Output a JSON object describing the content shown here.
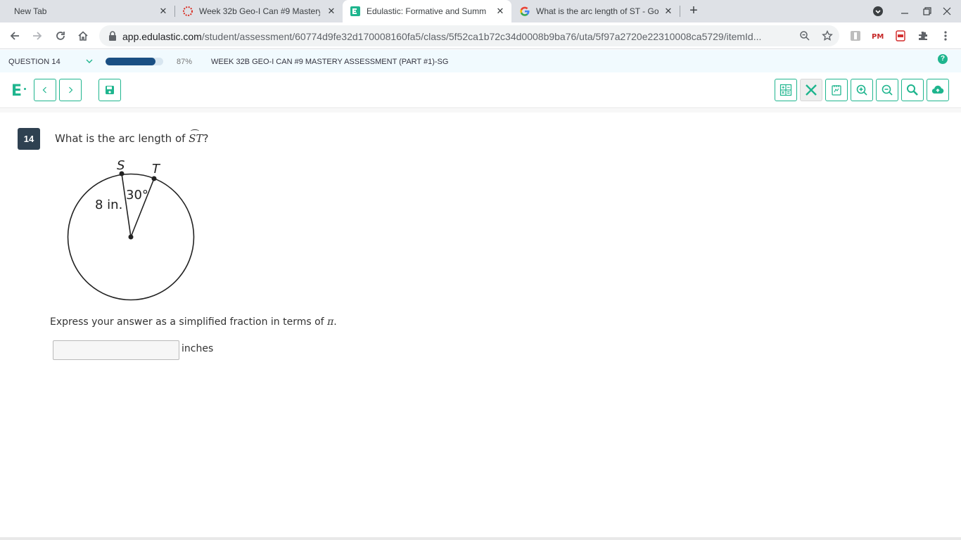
{
  "browser": {
    "tabs": [
      {
        "title": "New Tab",
        "favicon": "none",
        "active": false
      },
      {
        "title": "Week 32b Geo-I Can #9 Mastery",
        "favicon": "red-dotted-circle-icon",
        "active": false
      },
      {
        "title": "Edulastic: Formative and Summ",
        "favicon": "edulastic-icon",
        "active": true
      },
      {
        "title": "What is the arc length of ST - Go",
        "favicon": "google-icon",
        "active": false
      }
    ],
    "url_host": "app.edulastic.com",
    "url_path": "/student/assessment/60774d9fe32d170008160fa5/class/5f52ca1b72c34d0008b9ba76/uta/5f97a2720e22310008ca5729/itemId..."
  },
  "assessment": {
    "question_label": "QUESTION 14",
    "progress_percent": 87,
    "progress_text": "87%",
    "title": "WEEK 32B GEO-I CAN #9 MASTERY ASSESSMENT (PART #1)-SG",
    "help_label": "?"
  },
  "question": {
    "number": "14",
    "prompt_before": "What is the arc length of ",
    "arc_name": "ST",
    "prompt_after": "?",
    "figure": {
      "point_s": "S",
      "point_t": "T",
      "radius_label": "8 in.",
      "angle_label": "30°"
    },
    "instruction_before": "Express your answer as a simplified fraction in terms of ",
    "instruction_symbol": "π",
    "instruction_after": ".",
    "answer_value": "",
    "answer_unit": "inches"
  },
  "colors": {
    "brand": "#1fb58e",
    "question_badge": "#2f4151",
    "progress_fill": "#1a4f83"
  }
}
